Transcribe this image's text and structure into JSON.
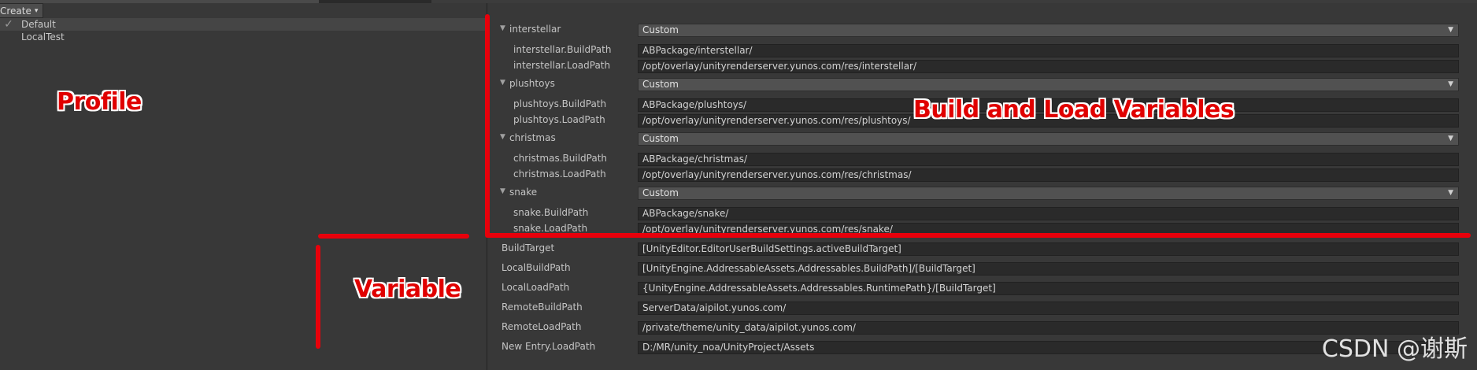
{
  "toolbar": {
    "create_label": "Create",
    "create_caret": "▾"
  },
  "profiles": [
    {
      "name": "Default",
      "checked": true,
      "check_glyph": "✓"
    },
    {
      "name": "LocalTest",
      "checked": false,
      "check_glyph": ""
    }
  ],
  "groups": [
    {
      "name": "interstellar",
      "mode": "Custom",
      "build_label": "interstellar.BuildPath",
      "build_value": "ABPackage/interstellar/",
      "load_label": "interstellar.LoadPath",
      "load_value": "/opt/overlay/unityrenderserver.yunos.com/res/interstellar/"
    },
    {
      "name": "plushtoys",
      "mode": "Custom",
      "build_label": "plushtoys.BuildPath",
      "build_value": "ABPackage/plushtoys/",
      "load_label": "plushtoys.LoadPath",
      "load_value": "/opt/overlay/unityrenderserver.yunos.com/res/plushtoys/"
    },
    {
      "name": "christmas",
      "mode": "Custom",
      "build_label": "christmas.BuildPath",
      "build_value": "ABPackage/christmas/",
      "load_label": "christmas.LoadPath",
      "load_value": "/opt/overlay/unityrenderserver.yunos.com/res/christmas/"
    },
    {
      "name": "snake",
      "mode": "Custom",
      "build_label": "snake.BuildPath",
      "build_value": "ABPackage/snake/",
      "load_label": "snake.LoadPath",
      "load_value": "/opt/overlay/unityrenderserver.yunos.com/res/snake/"
    }
  ],
  "variables": [
    {
      "label": "BuildTarget",
      "value": "[UnityEditor.EditorUserBuildSettings.activeBuildTarget]"
    },
    {
      "label": "LocalBuildPath",
      "value": "[UnityEngine.AddressableAssets.Addressables.BuildPath]/[BuildTarget]"
    },
    {
      "label": "LocalLoadPath",
      "value": "{UnityEngine.AddressableAssets.Addressables.RuntimePath}/[BuildTarget]"
    },
    {
      "label": "RemoteBuildPath",
      "value": "ServerData/aipilot.yunos.com/"
    },
    {
      "label": "RemoteLoadPath",
      "value": "/private/theme/unity_data/aipilot.yunos.com/"
    },
    {
      "label": "New Entry.LoadPath",
      "value": "D:/MR/unity_noa/UnityProject/Assets"
    }
  ],
  "icons": {
    "foldout": "▼",
    "dropdown_arrow": "▼"
  },
  "annotations": {
    "profile": "Profile",
    "build_load": "Build and Load Variables",
    "variable": "Variable",
    "color": "#e8000b"
  },
  "watermark": "CSDN @谢斯"
}
